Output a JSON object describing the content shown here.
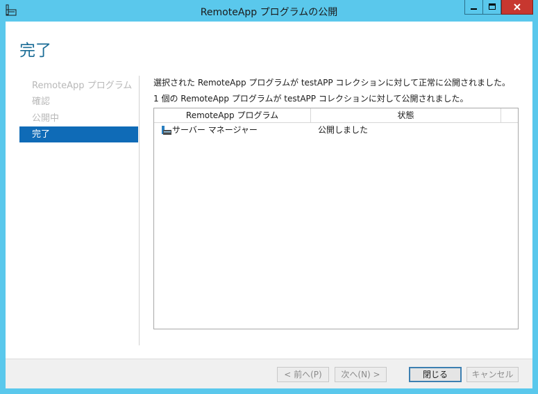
{
  "window": {
    "title": "RemoteApp プログラムの公開",
    "colors": {
      "titlebar": "#5ac8ec",
      "close": "#c7372f",
      "accent": "#0f6bb7",
      "heading": "#1a6c96"
    }
  },
  "page": {
    "heading": "完了"
  },
  "steps": [
    {
      "label": "RemoteApp プログラム",
      "active": false
    },
    {
      "label": "確認",
      "active": false
    },
    {
      "label": "公開中",
      "active": false
    },
    {
      "label": "完了",
      "active": true
    }
  ],
  "messages": {
    "line1": "選択された RemoteApp プログラムが testAPP コレクションに対して正常に公開されました。",
    "line2": "1 個の RemoteApp プログラムが testAPP コレクションに対して公開されました。"
  },
  "table": {
    "columns": [
      "RemoteApp プログラム",
      "状態"
    ],
    "rows": [
      {
        "icon": "server-manager-icon",
        "program": "サーバー マネージャー",
        "status": "公開しました"
      }
    ]
  },
  "footer": {
    "prev_label": "< 前へ(P)",
    "next_label": "次へ(N) >",
    "close_label": "閉じる",
    "cancel_label": "キャンセル"
  }
}
